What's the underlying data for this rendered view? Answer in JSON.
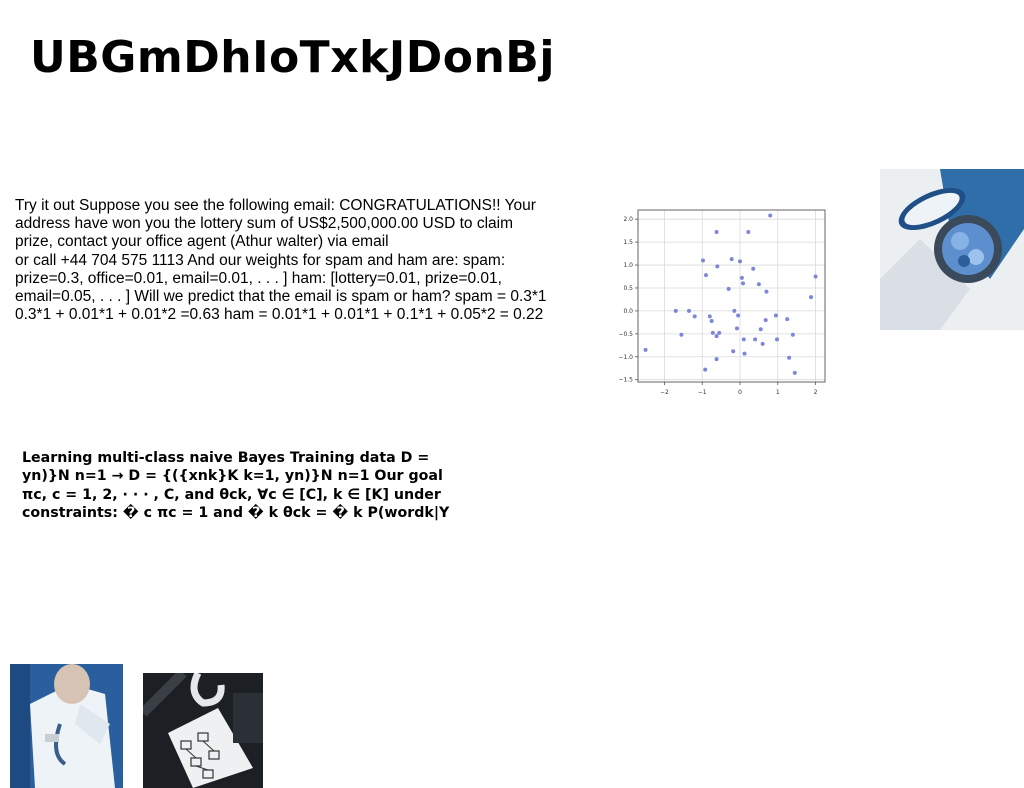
{
  "title": "UBGmDhIoTxkJDonBj",
  "paragraph1_lines": [
    "Try it out Suppose you see the following email: CONGRATULATIONS!! Your",
    "address have won you the lottery sum of US$2,500,000.00 USD to claim",
    "prize, contact your office agent (Athur walter) via email",
    "or call +44 704 575 1113 And our weights for spam and ham are: spam:",
    "prize=0.3, office=0.01, email=0.01, . . . ] ham: [lottery=0.01, prize=0.01,",
    "email=0.05, . . . ] Will we predict that the email is spam or ham? spam = 0.3*1",
    "0.3*1 + 0.01*1 + 0.01*2 =0.63 ham = 0.01*1 + 0.01*1 + 0.1*1 + 0.05*2 = 0.22"
  ],
  "paragraph2_lines": [
    "Learning multi-class naive Bayes Training data D =",
    "yn)}N n=1 → D = {({xnk}K k=1, yn)}N n=1 Our goal",
    "πc, c = 1, 2, · · · , C, and θck, ∀c ∈ [C], k ∈ [K] under",
    "constraints: � c πc = 1 and � k θck = � k P(wordk|Y"
  ],
  "chart_data": {
    "type": "scatter",
    "title": "",
    "xlabel": "",
    "ylabel": "",
    "xlim": [
      -2.7,
      2.25
    ],
    "ylim": [
      -1.55,
      2.2
    ],
    "xticks": [
      -2,
      -1,
      0,
      1,
      2
    ],
    "yticks": [
      -1.5,
      -1.0,
      -0.5,
      0.0,
      0.5,
      1.0,
      1.5,
      2.0
    ],
    "xtick_labels": [
      "−2",
      "−1",
      "0",
      "1",
      "2"
    ],
    "ytick_labels": [
      "−1.5",
      "−1.0",
      "−0.5",
      "0.0",
      "0.5",
      "1.0",
      "1.5",
      "2.0"
    ],
    "grid": true,
    "marker_color": "#7d86d8",
    "points": [
      [
        -2.5,
        -0.85
      ],
      [
        -1.7,
        0.0
      ],
      [
        -1.55,
        -0.52
      ],
      [
        -1.35,
        0.0
      ],
      [
        -1.2,
        -0.12
      ],
      [
        -0.98,
        1.1
      ],
      [
        -0.9,
        0.78
      ],
      [
        -0.92,
        -1.28
      ],
      [
        -0.8,
        -0.12
      ],
      [
        -0.75,
        -0.22
      ],
      [
        -0.72,
        -0.48
      ],
      [
        -0.62,
        1.72
      ],
      [
        -0.6,
        0.97
      ],
      [
        -0.62,
        -0.55
      ],
      [
        -0.55,
        -0.48
      ],
      [
        -0.62,
        -1.05
      ],
      [
        -0.3,
        0.48
      ],
      [
        -0.22,
        1.13
      ],
      [
        -0.15,
        0.0
      ],
      [
        -0.18,
        -0.88
      ],
      [
        -0.08,
        -0.38
      ],
      [
        -0.05,
        -0.1
      ],
      [
        0.0,
        1.08
      ],
      [
        0.05,
        0.72
      ],
      [
        0.08,
        0.6
      ],
      [
        0.1,
        -0.62
      ],
      [
        0.12,
        -0.93
      ],
      [
        0.22,
        1.72
      ],
      [
        0.35,
        0.92
      ],
      [
        0.4,
        -0.62
      ],
      [
        0.5,
        0.58
      ],
      [
        0.55,
        -0.4
      ],
      [
        0.6,
        -0.72
      ],
      [
        0.68,
        -0.2
      ],
      [
        0.7,
        0.42
      ],
      [
        0.8,
        2.08
      ],
      [
        0.95,
        -0.1
      ],
      [
        0.98,
        -0.62
      ],
      [
        1.25,
        -0.18
      ],
      [
        1.3,
        -1.02
      ],
      [
        1.4,
        -0.52
      ],
      [
        1.45,
        -1.35
      ],
      [
        1.88,
        0.3
      ],
      [
        2.0,
        0.75
      ]
    ]
  },
  "images": [
    {
      "icon": "table-food-photo"
    },
    {
      "icon": "doctor-photo"
    },
    {
      "icon": "desk-flowchart-photo"
    }
  ]
}
